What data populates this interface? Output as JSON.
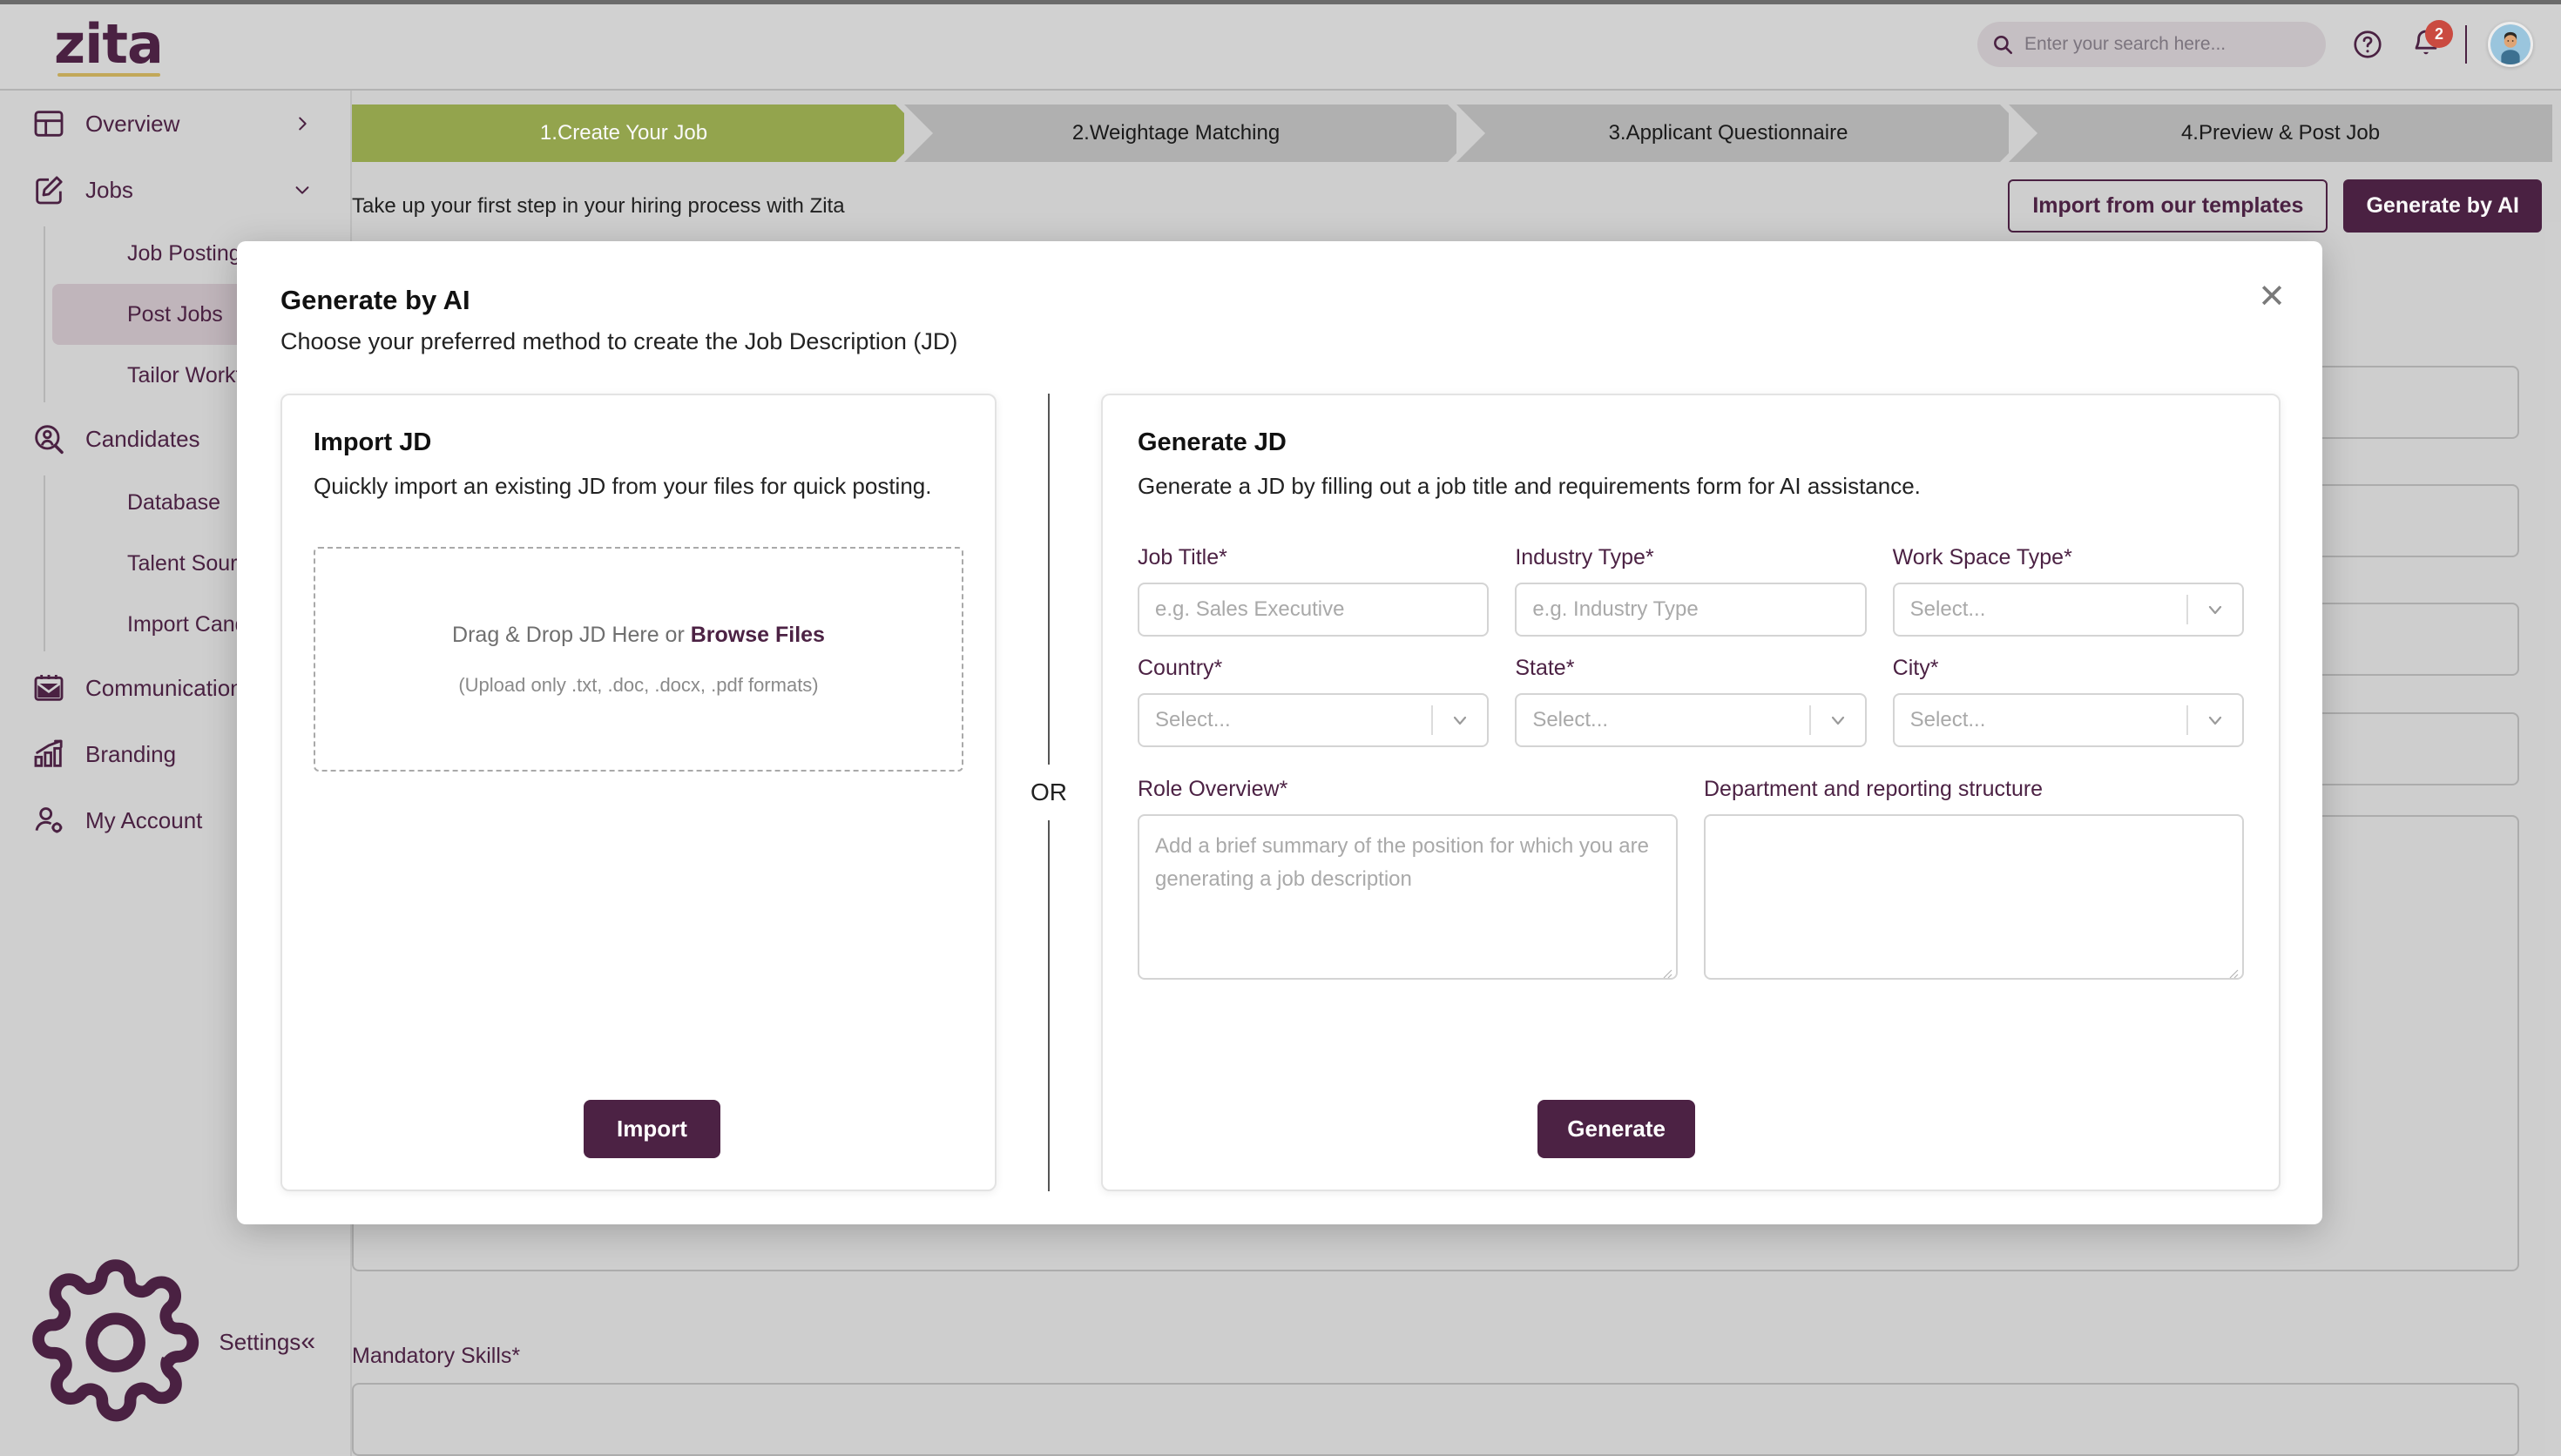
{
  "brand": {
    "logo": "zita",
    "accent": "#4c2244",
    "active_step_color": "#96a84f",
    "badge_color": "#cf4c42",
    "logo_underline": "#c6ac5b"
  },
  "topbar": {
    "search_placeholder": "Enter your search here...",
    "search_value": "",
    "help_icon": "question-circle-icon",
    "bell_icon": "notification-bell-icon",
    "notification_count": "2",
    "avatar": "user-avatar"
  },
  "sidebar": {
    "items": [
      {
        "label": "Overview",
        "icon": "dashboard-icon",
        "chevron": "chevron-right-icon"
      },
      {
        "label": "Jobs",
        "icon": "edit-square-icon",
        "chevron": "chevron-down-icon"
      }
    ],
    "jobs_children": [
      {
        "label": "Job Posting",
        "active": false
      },
      {
        "label": "Post Jobs",
        "active": true
      },
      {
        "label": "Tailor Workflow",
        "active": false
      }
    ],
    "candidates": {
      "label": "Candidates",
      "icon": "candidate-search-icon"
    },
    "candidates_children": [
      {
        "label": "Database"
      },
      {
        "label": "Talent Sourcing"
      },
      {
        "label": "Import Candidates"
      }
    ],
    "more": [
      {
        "label": "Communication",
        "icon": "mail-calendar-icon"
      },
      {
        "label": "Branding",
        "icon": "bar-chart-arrow-icon"
      },
      {
        "label": "My Account",
        "icon": "user-gear-icon"
      }
    ],
    "settings": {
      "label": "Settings",
      "icon": "gear-icon"
    },
    "collapse": "«"
  },
  "main": {
    "steps": [
      {
        "label": "1.Create Your Job",
        "active": true
      },
      {
        "label": "2.Weightage Matching",
        "active": false
      },
      {
        "label": "3.Applicant Questionnaire",
        "active": false
      },
      {
        "label": "4.Preview & Post Job",
        "active": false
      }
    ],
    "subhead": "Take up your first step in your hiring process with Zita",
    "import_templates_label": "Import from our templates",
    "generate_by_ai_label": "Generate by AI",
    "mandatory_skills_label": "Mandatory Skills",
    "required_marker": "*"
  },
  "modal": {
    "title": "Generate by AI",
    "subtitle": "Choose your preferred method to create the Job Description (JD)",
    "close_icon": "close-icon",
    "or_label": "OR",
    "import_card": {
      "heading": "Import JD",
      "description": "Quickly import an existing JD from your files for quick posting.",
      "dropzone_text": "Drag & Drop JD Here or ",
      "dropzone_link": "Browse Files",
      "dropzone_hint": "(Upload only .txt, .doc, .docx, .pdf formats)",
      "button_label": "Import"
    },
    "generate_card": {
      "heading": "Generate JD",
      "description": "Generate a JD by filling out a job title and requirements form for AI assistance.",
      "button_label": "Generate",
      "fields": [
        {
          "label": "Job Title",
          "required": "*",
          "type": "text",
          "placeholder": "e.g. Sales Executive",
          "value": ""
        },
        {
          "label": "Industry Type",
          "required": "*",
          "type": "text",
          "placeholder": "e.g. Industry Type",
          "value": ""
        },
        {
          "label": "Work Space Type",
          "required": "*",
          "type": "select",
          "placeholder": "Select...",
          "value": ""
        },
        {
          "label": "Country",
          "required": "*",
          "type": "select",
          "placeholder": "Select...",
          "value": ""
        },
        {
          "label": "State",
          "required": "*",
          "type": "select",
          "placeholder": "Select...",
          "value": ""
        },
        {
          "label": "City",
          "required": "*",
          "type": "select",
          "placeholder": "Select...",
          "value": ""
        }
      ],
      "textareas": [
        {
          "label": "Role Overview",
          "required": "*",
          "placeholder": "Add a brief summary of the position for which you are generating a job description",
          "value": ""
        },
        {
          "label": "Department and reporting structure",
          "required": "",
          "placeholder": "",
          "value": ""
        }
      ]
    }
  }
}
